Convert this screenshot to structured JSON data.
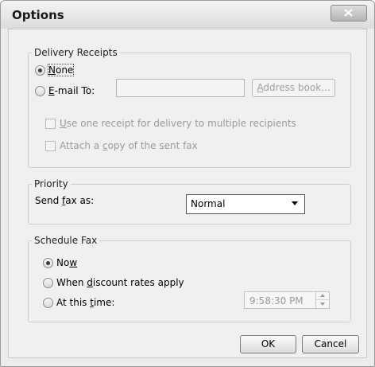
{
  "dialog": {
    "title": "Options",
    "close_icon": "close-icon"
  },
  "delivery_receipts": {
    "legend": "Delivery Receipts",
    "none_prefix": "",
    "none_underlined": "N",
    "none_rest": "one",
    "none_selected": true,
    "email_underlined": "E",
    "email_rest": "-mail To:",
    "email_value": "",
    "address_book_underlined": "A",
    "address_book_rest": "ddress book...",
    "use_one_receipt_underlined": "U",
    "use_one_receipt_rest": "se one receipt for delivery to multiple recipients",
    "attach_prefix": "Attach a ",
    "attach_underlined": "c",
    "attach_rest": "opy of the sent fax"
  },
  "priority": {
    "legend": "Priority",
    "send_prefix": "Send ",
    "send_underlined": "f",
    "send_rest": "ax as:",
    "selected_value": "Normal"
  },
  "schedule": {
    "legend": "Schedule Fax",
    "now_prefix": "No",
    "now_underlined": "w",
    "now_rest": "",
    "now_selected": true,
    "discount_prefix": "When ",
    "discount_underlined": "d",
    "discount_rest": "iscount rates apply",
    "at_time_prefix": "At this ",
    "at_time_underlined": "t",
    "at_time_rest": "ime:",
    "time_value": "9:58:30 PM"
  },
  "buttons": {
    "ok": "OK",
    "cancel": "Cancel"
  },
  "colors": {
    "window_bg": "#f0f0f0",
    "disabled_text": "#9b9b9b"
  }
}
